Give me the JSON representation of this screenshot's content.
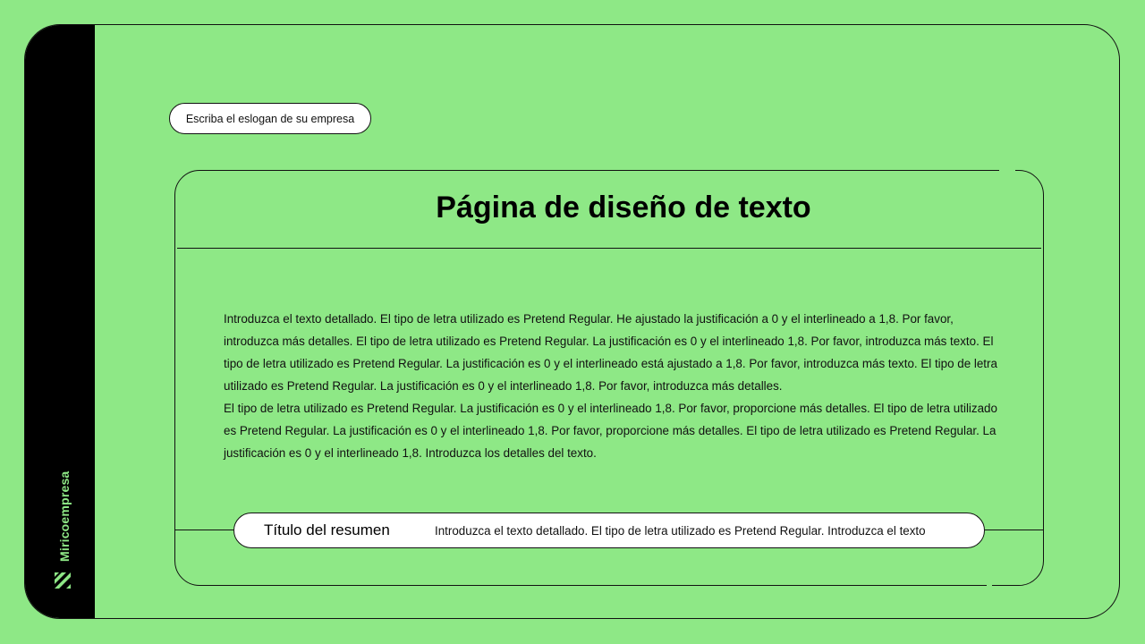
{
  "brand": {
    "name": "Miricoempresa",
    "logo_icon": "diagonal-stripes-logo-icon",
    "color": "#8ee886"
  },
  "slogan": {
    "text": "Escriba el eslogan de su empresa"
  },
  "page": {
    "title": "Página de diseño de texto",
    "background": "#8ee886",
    "paragraphs": [
      "Introduzca el texto detallado. El tipo de letra utilizado es Pretend Regular. He ajustado la justificación a 0 y el interlineado a 1,8. Por favor, introduzca más detalles. El tipo de letra utilizado es Pretend Regular. La justificación es 0 y el interlineado 1,8. Por favor, introduzca más texto. El tipo de letra utilizado es Pretend Regular. La justificación es 0 y el interlineado está ajustado a 1,8. Por favor, introduzca más texto. El tipo de letra utilizado es Pretend Regular. La justificación es 0 y el interlineado 1,8. Por favor, introduzca más detalles.",
      "El tipo de letra utilizado es Pretend Regular. La justificación es 0 y el interlineado 1,8. Por favor, proporcione más detalles. El tipo de letra utilizado es Pretend Regular. La justificación es 0 y el interlineado 1,8. Por favor, proporcione más detalles. El tipo de letra utilizado es Pretend Regular. La justificación es 0 y el interlineado 1,8. Introduzca los detalles del texto."
    ]
  },
  "summary": {
    "title": "Título del resumen",
    "text": "Introduzca el texto detallado. El tipo de letra utilizado es Pretend Regular. Introduzca el texto"
  }
}
